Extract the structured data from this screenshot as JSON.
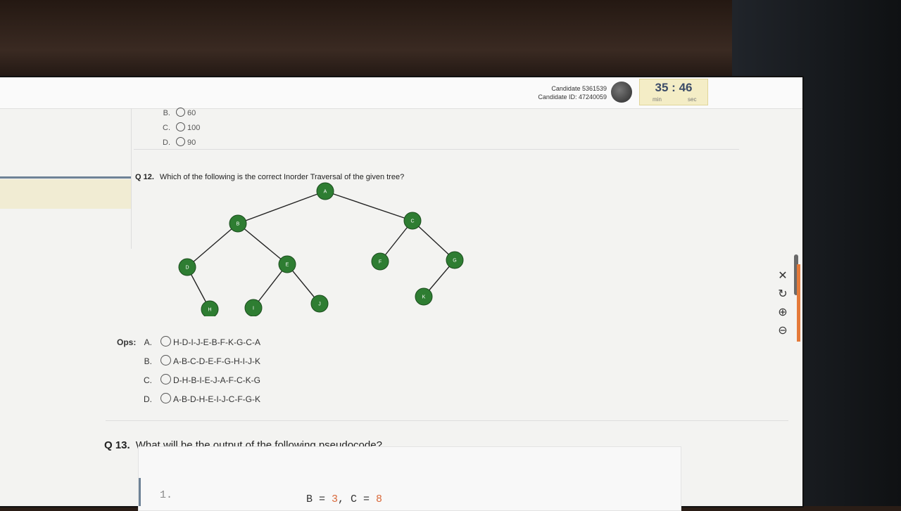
{
  "header": {
    "candidate_name": "Candidate 5361539",
    "candidate_id": "Candidate ID: 47240059",
    "timer": {
      "minutes": "35",
      "separator": ":",
      "seconds": "46",
      "min_label": "min",
      "sec_label": "sec"
    }
  },
  "prev_question_options": [
    {
      "letter": "B.",
      "text": "60"
    },
    {
      "letter": "C.",
      "text": "100"
    },
    {
      "letter": "D.",
      "text": "90"
    }
  ],
  "q12": {
    "number": "Q 12.",
    "text": "Which of the following is the correct Inorder Traversal of the given tree?",
    "ops_label": "Ops:",
    "options": [
      {
        "letter": "A.",
        "text": "H-D-I-J-E-B-F-K-G-C-A"
      },
      {
        "letter": "B.",
        "text": "A-B-C-D-E-F-G-H-I-J-K"
      },
      {
        "letter": "C.",
        "text": "D-H-B-I-E-J-A-F-C-K-G"
      },
      {
        "letter": "D.",
        "text": "A-B-D-H-E-I-J-C-F-G-K"
      }
    ],
    "tree": {
      "node_color": "#2e7d32",
      "nodes": [
        "A",
        "B",
        "C",
        "D",
        "E",
        "F",
        "G",
        "H",
        "I",
        "J",
        "K"
      ],
      "edges": [
        [
          "A",
          "B"
        ],
        [
          "A",
          "C"
        ],
        [
          "B",
          "D"
        ],
        [
          "B",
          "E"
        ],
        [
          "D",
          "H"
        ],
        [
          "E",
          "I"
        ],
        [
          "E",
          "J"
        ],
        [
          "C",
          "F"
        ],
        [
          "C",
          "G"
        ],
        [
          "G",
          "K"
        ]
      ]
    }
  },
  "q13": {
    "number": "Q 13.",
    "text": "What will be the output of the following pseudocode?",
    "code_line_number": "1.",
    "code_prefix": "B = ",
    "code_b": "3",
    "code_mid": ", C = ",
    "code_c": "8"
  },
  "tools": [
    "close-icon",
    "rotate-icon",
    "zoom-in-icon",
    "zoom-out-icon"
  ],
  "accent_color": "#e47a3a"
}
